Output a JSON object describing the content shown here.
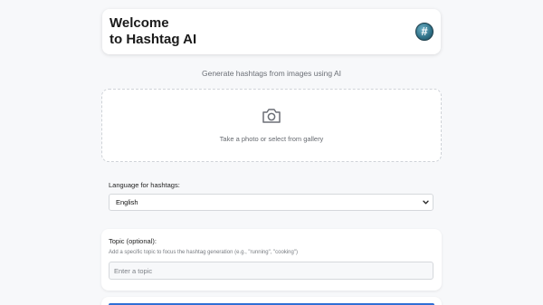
{
  "header": {
    "title_line1": "Welcome",
    "title_line2": "to Hashtag AI",
    "logo_mark": "#",
    "logo_icon": "hashtag-logo-icon"
  },
  "subtitle": "Generate hashtags from images using AI",
  "upload": {
    "icon": "camera-icon",
    "text": "Take a photo or select from gallery"
  },
  "language": {
    "label": "Language for hashtags:",
    "selected": "English"
  },
  "topic": {
    "label": "Topic (optional):",
    "help": "Add a specific topic to focus the hashtag generation (e.g., \"running\", \"cooking\")",
    "value": "",
    "placeholder": "Enter a topic"
  },
  "colors": {
    "accent": "#2f6fd6",
    "logo": "#2e6f85",
    "background": "#f7f8fa"
  }
}
